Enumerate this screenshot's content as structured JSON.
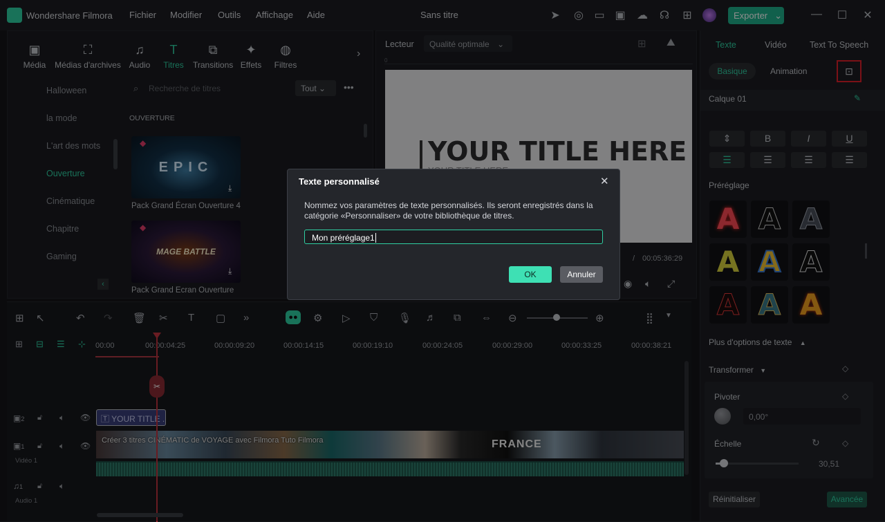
{
  "app": {
    "name": "Wondershare Filmora",
    "project_title": "Sans titre",
    "export_label": "Exporter"
  },
  "menu": [
    "Fichier",
    "Modifier",
    "Outils",
    "Affichage",
    "Aide"
  ],
  "library": {
    "tabs": [
      {
        "label": "Média",
        "icon": "media-icon"
      },
      {
        "label": "Médias d'archives",
        "icon": "stock-media-icon"
      },
      {
        "label": "Audio",
        "icon": "audio-icon"
      },
      {
        "label": "Titres",
        "icon": "titles-icon"
      },
      {
        "label": "Transitions",
        "icon": "transitions-icon"
      },
      {
        "label": "Effets",
        "icon": "effects-icon"
      },
      {
        "label": "Filtres",
        "icon": "filters-icon"
      }
    ],
    "categories": [
      "Halloween",
      "la mode",
      "L'art des mots",
      "Ouverture",
      "Cinématique",
      "Chapitre",
      "Gaming"
    ],
    "active_category": "Ouverture",
    "search_placeholder": "Recherche de titres",
    "filter": "Tout",
    "section_title": "OUVERTURE",
    "items": [
      {
        "name": "Pack Grand Écran Ouverture 4",
        "thumb_text": "EPIC"
      },
      {
        "name": "Pack Grand Écran Ouverture",
        "thumb_text": "MAGE BATTLE"
      }
    ]
  },
  "player": {
    "label": "Lecteur",
    "quality": "Qualité optimale",
    "preview_title": "YOUR TITLE HERE",
    "preview_subtitle": "YOUR TITLE HERE",
    "time_sep": "/",
    "duration": "00:05:36:29"
  },
  "properties": {
    "tabs": [
      "Texte",
      "Vidéo",
      "Text To Speech"
    ],
    "subtabs": [
      "Basique",
      "Animation"
    ],
    "layer": "Calque 01",
    "format_buttons": [
      "B",
      "I",
      "U"
    ],
    "preset_label": "Préréglage",
    "more_options": "Plus d'options de texte",
    "transform": "Transformer",
    "rotate_label": "Pivoter",
    "rotate_value": "0,00°",
    "scale_label": "Échelle",
    "scale_value": "30,51",
    "scale_fraction": 0.1,
    "reset": "Réinitialiser",
    "advanced": "Avancée"
  },
  "timeline": {
    "ruler": [
      "00:00",
      "00:00:04:25",
      "00:00:09:20",
      "00:00:14:15",
      "00:00:19:10",
      "00:00:24:05",
      "00:00:29:00",
      "00:00:33:25",
      "00:00:38:21"
    ],
    "tracks": [
      {
        "num": "2",
        "label": ""
      },
      {
        "num": "1",
        "label": "Vidéo 1"
      },
      {
        "num": "1",
        "label": "Audio 1"
      }
    ],
    "title_clip": "YOUR TITLE ...",
    "video_clip": "Créer 3 titres CINÉMATIC de VOYAGE avec Filmora  Tuto Filmora",
    "france_text": "FRANCE"
  },
  "dialog": {
    "title": "Texte personnalisé",
    "message": "Nommez vos paramètres de texte personnalisés. Ils seront enregistrés dans la catégorie «Personnaliser» de votre bibliothèque de titres.",
    "input_value": "Mon préréglage1",
    "ok": "OK",
    "cancel": "Annuler"
  },
  "colors": {
    "accent": "#2fd0a3",
    "highlight_box": "#e0202a",
    "export_bg": "#1fb08a"
  }
}
